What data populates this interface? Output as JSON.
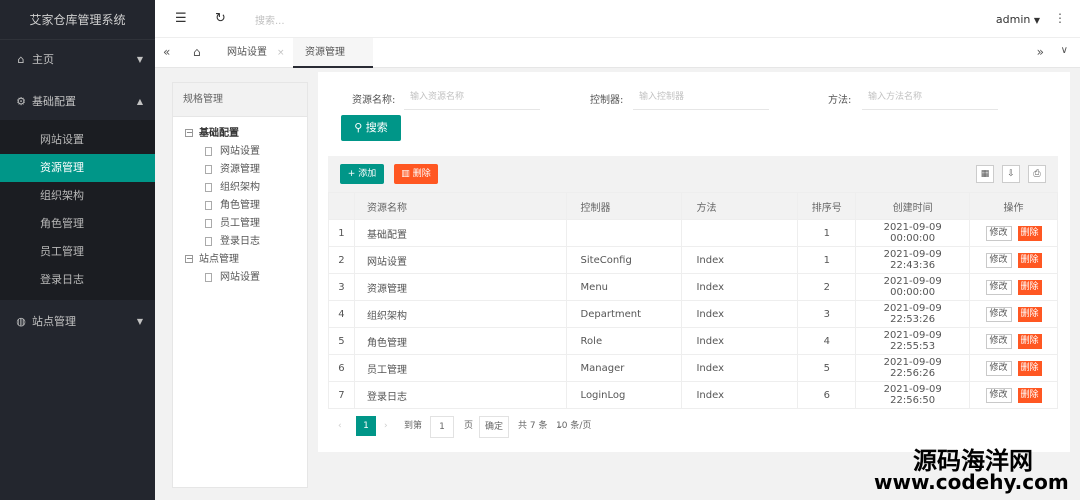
{
  "app": {
    "title": "艾家仓库管理系统"
  },
  "sidebar": {
    "items": [
      {
        "label": "主页",
        "icon": "home-icon"
      },
      {
        "label": "基础配置",
        "icon": "gear-icon"
      },
      {
        "label": "站点管理",
        "icon": "globe-icon"
      }
    ],
    "sub_items": [
      {
        "label": "网站设置"
      },
      {
        "label": "资源管理"
      },
      {
        "label": "组织架构"
      },
      {
        "label": "角色管理"
      },
      {
        "label": "员工管理"
      },
      {
        "label": "登录日志"
      }
    ]
  },
  "header": {
    "search_placeholder": "搜索...",
    "user": "admin"
  },
  "tabs": [
    {
      "label": "网站设置"
    },
    {
      "label": "资源管理"
    }
  ],
  "tree": {
    "title": "规格管理",
    "groups": [
      {
        "label": "基础配置",
        "children": [
          "网站设置",
          "资源管理",
          "组织架构",
          "角色管理",
          "员工管理",
          "登录日志"
        ]
      },
      {
        "label": "站点管理",
        "children": [
          "网站设置"
        ]
      }
    ]
  },
  "filters": {
    "name_label": "资源名称:",
    "name_placeholder": "输入资源名称",
    "controller_label": "控制器:",
    "controller_placeholder": "输入控制器",
    "method_label": "方法:",
    "method_placeholder": "输入方法名称",
    "search_button": "搜索"
  },
  "toolbar": {
    "add": "添加",
    "delete": "删除"
  },
  "table": {
    "columns": [
      "资源名称",
      "控制器",
      "方法",
      "排序号",
      "创建时间",
      "操作"
    ],
    "edit_label": "修改",
    "delete_label": "删除",
    "rows": [
      {
        "num": "1",
        "name": "基础配置",
        "controller": "",
        "method": "",
        "order": "1",
        "created": "2021-09-09 00:00:00"
      },
      {
        "num": "2",
        "name": "网站设置",
        "controller": "SiteConfig",
        "method": "Index",
        "order": "1",
        "created": "2021-09-09 22:43:36"
      },
      {
        "num": "3",
        "name": "资源管理",
        "controller": "Menu",
        "method": "Index",
        "order": "2",
        "created": "2021-09-09 00:00:00"
      },
      {
        "num": "4",
        "name": "组织架构",
        "controller": "Department",
        "method": "Index",
        "order": "3",
        "created": "2021-09-09 22:53:26"
      },
      {
        "num": "5",
        "name": "角色管理",
        "controller": "Role",
        "method": "Index",
        "order": "4",
        "created": "2021-09-09 22:55:53"
      },
      {
        "num": "6",
        "name": "员工管理",
        "controller": "Manager",
        "method": "Index",
        "order": "5",
        "created": "2021-09-09 22:56:26"
      },
      {
        "num": "7",
        "name": "登录日志",
        "controller": "LoginLog",
        "method": "Index",
        "order": "6",
        "created": "2021-09-09 22:56:50"
      }
    ]
  },
  "pager": {
    "current": "1",
    "goto": "到第",
    "page_value": "1",
    "page_unit": "页",
    "confirm": "确定",
    "total": "共 7 条",
    "per_page": "10 条/页"
  },
  "watermark": {
    "line1": "源码海洋网",
    "line2": "www.codehy.com"
  },
  "colors": {
    "accent": "#009688",
    "danger": "#ff5722",
    "sidebar": "#23262e"
  }
}
